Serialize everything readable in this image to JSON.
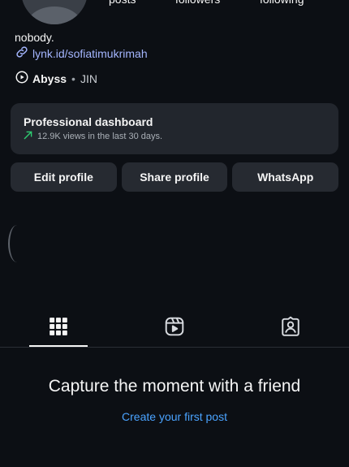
{
  "header": {
    "stats": [
      {
        "label": "posts"
      },
      {
        "label": "followers"
      },
      {
        "label": "following"
      }
    ]
  },
  "bio": {
    "name": "nobody.",
    "link": "lynk.id/sofiatimukrimah"
  },
  "music": {
    "song": "Abyss",
    "separator": "•",
    "artist": "JIN"
  },
  "dashboard": {
    "title": "Professional dashboard",
    "subtitle": "12.9K views in the last 30 days."
  },
  "actions": {
    "edit": "Edit profile",
    "share": "Share profile",
    "whatsapp": "WhatsApp"
  },
  "tabs": {
    "items": [
      {
        "icon": "grid-icon",
        "active": true
      },
      {
        "icon": "reels-icon",
        "active": false
      },
      {
        "icon": "tagged-icon",
        "active": false
      }
    ]
  },
  "empty": {
    "title": "Capture the moment with a friend",
    "cta": "Create your first post"
  },
  "colors": {
    "background": "#0c0f14",
    "card": "#22262d",
    "button": "#262a31",
    "link": "#a4b6ff",
    "cta": "#4aa3ff",
    "trend": "#2ecc71"
  }
}
